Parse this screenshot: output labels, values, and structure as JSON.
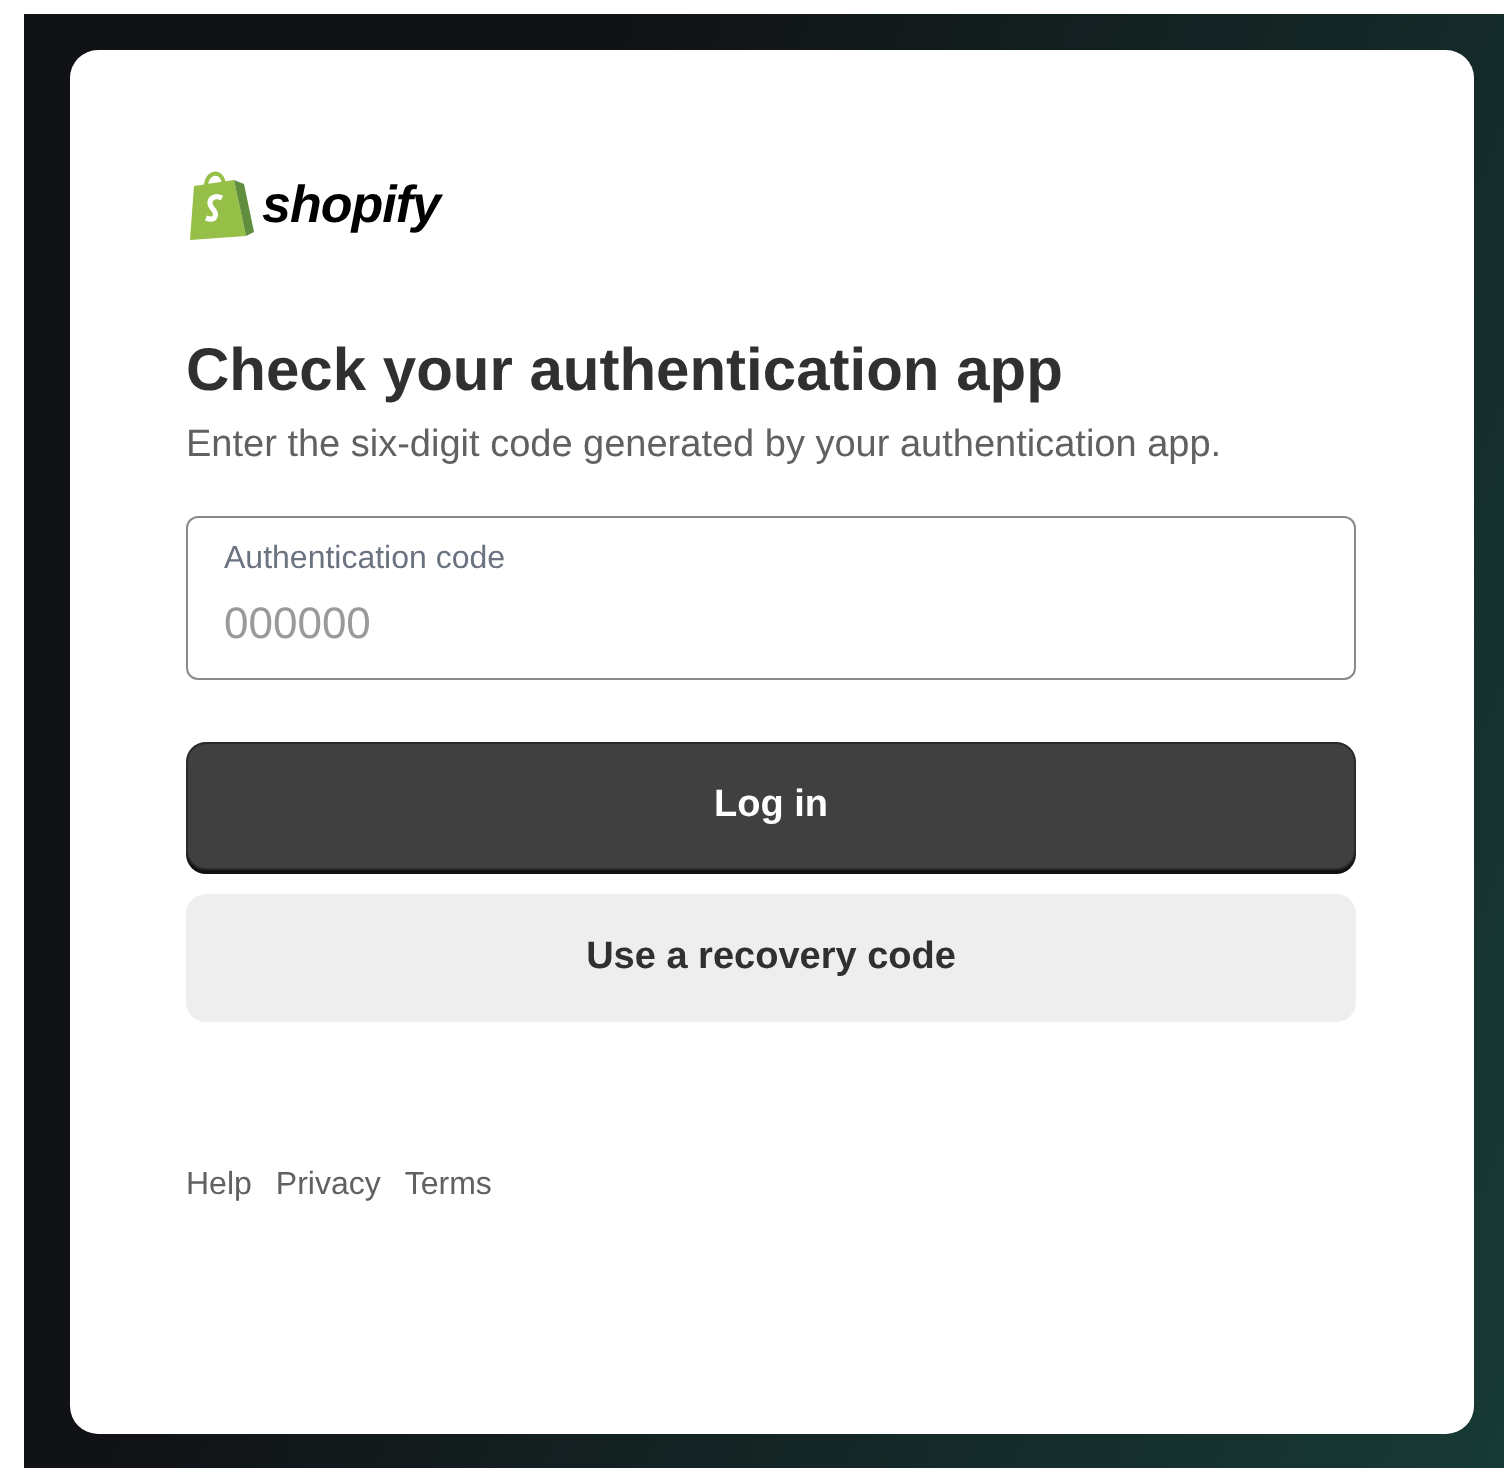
{
  "logo": {
    "wordmark": "shopify"
  },
  "heading": "Check your authentication app",
  "subtitle": "Enter the six-digit code generated by your authentication app.",
  "code_field": {
    "label": "Authentication code",
    "placeholder": "000000"
  },
  "buttons": [
    {
      "label": "Log in",
      "kind": "primary"
    },
    {
      "label": "Use a recovery code",
      "kind": "secondary"
    }
  ],
  "footer_links": [
    "Help",
    "Privacy",
    "Terms"
  ]
}
